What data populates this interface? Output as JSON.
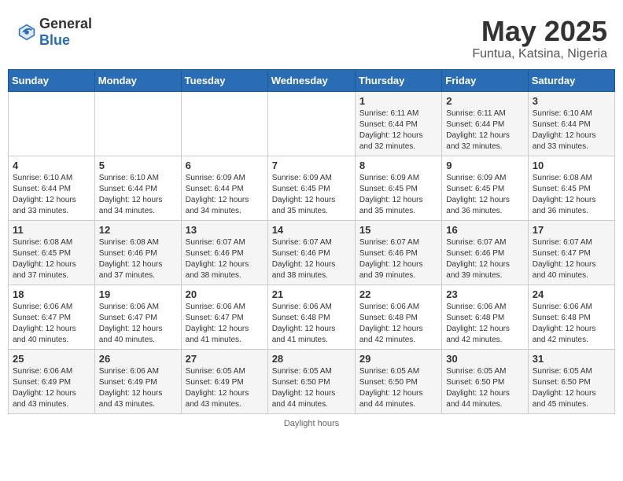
{
  "header": {
    "logo_general": "General",
    "logo_blue": "Blue",
    "month": "May 2025",
    "location": "Funtua, Katsina, Nigeria"
  },
  "days_of_week": [
    "Sunday",
    "Monday",
    "Tuesday",
    "Wednesday",
    "Thursday",
    "Friday",
    "Saturday"
  ],
  "footer": "Daylight hours",
  "weeks": [
    [
      {
        "day": "",
        "info": ""
      },
      {
        "day": "",
        "info": ""
      },
      {
        "day": "",
        "info": ""
      },
      {
        "day": "",
        "info": ""
      },
      {
        "day": "1",
        "info": "Sunrise: 6:11 AM\nSunset: 6:44 PM\nDaylight: 12 hours\nand 32 minutes."
      },
      {
        "day": "2",
        "info": "Sunrise: 6:11 AM\nSunset: 6:44 PM\nDaylight: 12 hours\nand 32 minutes."
      },
      {
        "day": "3",
        "info": "Sunrise: 6:10 AM\nSunset: 6:44 PM\nDaylight: 12 hours\nand 33 minutes."
      }
    ],
    [
      {
        "day": "4",
        "info": "Sunrise: 6:10 AM\nSunset: 6:44 PM\nDaylight: 12 hours\nand 33 minutes."
      },
      {
        "day": "5",
        "info": "Sunrise: 6:10 AM\nSunset: 6:44 PM\nDaylight: 12 hours\nand 34 minutes."
      },
      {
        "day": "6",
        "info": "Sunrise: 6:09 AM\nSunset: 6:44 PM\nDaylight: 12 hours\nand 34 minutes."
      },
      {
        "day": "7",
        "info": "Sunrise: 6:09 AM\nSunset: 6:45 PM\nDaylight: 12 hours\nand 35 minutes."
      },
      {
        "day": "8",
        "info": "Sunrise: 6:09 AM\nSunset: 6:45 PM\nDaylight: 12 hours\nand 35 minutes."
      },
      {
        "day": "9",
        "info": "Sunrise: 6:09 AM\nSunset: 6:45 PM\nDaylight: 12 hours\nand 36 minutes."
      },
      {
        "day": "10",
        "info": "Sunrise: 6:08 AM\nSunset: 6:45 PM\nDaylight: 12 hours\nand 36 minutes."
      }
    ],
    [
      {
        "day": "11",
        "info": "Sunrise: 6:08 AM\nSunset: 6:45 PM\nDaylight: 12 hours\nand 37 minutes."
      },
      {
        "day": "12",
        "info": "Sunrise: 6:08 AM\nSunset: 6:46 PM\nDaylight: 12 hours\nand 37 minutes."
      },
      {
        "day": "13",
        "info": "Sunrise: 6:07 AM\nSunset: 6:46 PM\nDaylight: 12 hours\nand 38 minutes."
      },
      {
        "day": "14",
        "info": "Sunrise: 6:07 AM\nSunset: 6:46 PM\nDaylight: 12 hours\nand 38 minutes."
      },
      {
        "day": "15",
        "info": "Sunrise: 6:07 AM\nSunset: 6:46 PM\nDaylight: 12 hours\nand 39 minutes."
      },
      {
        "day": "16",
        "info": "Sunrise: 6:07 AM\nSunset: 6:46 PM\nDaylight: 12 hours\nand 39 minutes."
      },
      {
        "day": "17",
        "info": "Sunrise: 6:07 AM\nSunset: 6:47 PM\nDaylight: 12 hours\nand 40 minutes."
      }
    ],
    [
      {
        "day": "18",
        "info": "Sunrise: 6:06 AM\nSunset: 6:47 PM\nDaylight: 12 hours\nand 40 minutes."
      },
      {
        "day": "19",
        "info": "Sunrise: 6:06 AM\nSunset: 6:47 PM\nDaylight: 12 hours\nand 40 minutes."
      },
      {
        "day": "20",
        "info": "Sunrise: 6:06 AM\nSunset: 6:47 PM\nDaylight: 12 hours\nand 41 minutes."
      },
      {
        "day": "21",
        "info": "Sunrise: 6:06 AM\nSunset: 6:48 PM\nDaylight: 12 hours\nand 41 minutes."
      },
      {
        "day": "22",
        "info": "Sunrise: 6:06 AM\nSunset: 6:48 PM\nDaylight: 12 hours\nand 42 minutes."
      },
      {
        "day": "23",
        "info": "Sunrise: 6:06 AM\nSunset: 6:48 PM\nDaylight: 12 hours\nand 42 minutes."
      },
      {
        "day": "24",
        "info": "Sunrise: 6:06 AM\nSunset: 6:48 PM\nDaylight: 12 hours\nand 42 minutes."
      }
    ],
    [
      {
        "day": "25",
        "info": "Sunrise: 6:06 AM\nSunset: 6:49 PM\nDaylight: 12 hours\nand 43 minutes."
      },
      {
        "day": "26",
        "info": "Sunrise: 6:06 AM\nSunset: 6:49 PM\nDaylight: 12 hours\nand 43 minutes."
      },
      {
        "day": "27",
        "info": "Sunrise: 6:05 AM\nSunset: 6:49 PM\nDaylight: 12 hours\nand 43 minutes."
      },
      {
        "day": "28",
        "info": "Sunrise: 6:05 AM\nSunset: 6:50 PM\nDaylight: 12 hours\nand 44 minutes."
      },
      {
        "day": "29",
        "info": "Sunrise: 6:05 AM\nSunset: 6:50 PM\nDaylight: 12 hours\nand 44 minutes."
      },
      {
        "day": "30",
        "info": "Sunrise: 6:05 AM\nSunset: 6:50 PM\nDaylight: 12 hours\nand 44 minutes."
      },
      {
        "day": "31",
        "info": "Sunrise: 6:05 AM\nSunset: 6:50 PM\nDaylight: 12 hours\nand 45 minutes."
      }
    ]
  ]
}
